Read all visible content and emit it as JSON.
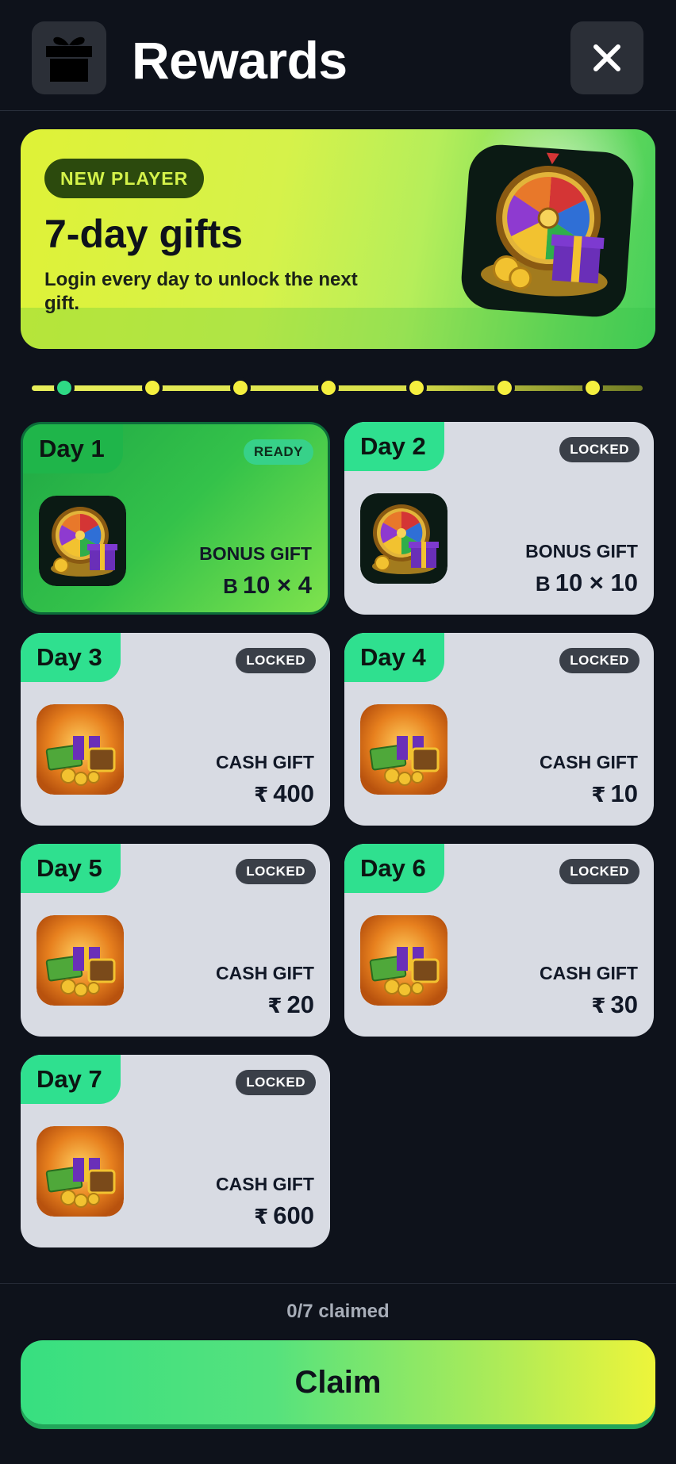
{
  "header": {
    "title": "Rewards"
  },
  "banner": {
    "badge": "NEW PLAYER",
    "title": "7-day gifts",
    "subtitle": "Login every day to unlock the next gift."
  },
  "progress": {
    "total_days": 7,
    "current_day": 1
  },
  "days": [
    {
      "label": "Day 1",
      "status": "READY",
      "gift_type": "BONUS GIFT",
      "currency": "B",
      "amount": "10 × 4",
      "art": "prize-wheel-icon"
    },
    {
      "label": "Day 2",
      "status": "LOCKED",
      "gift_type": "BONUS GIFT",
      "currency": "B",
      "amount": "10 × 10",
      "art": "prize-wheel-icon"
    },
    {
      "label": "Day 3",
      "status": "LOCKED",
      "gift_type": "CASH GIFT",
      "currency": "₹",
      "amount": "400",
      "art": "treasure-cash-icon"
    },
    {
      "label": "Day 4",
      "status": "LOCKED",
      "gift_type": "CASH GIFT",
      "currency": "₹",
      "amount": "10",
      "art": "treasure-cash-icon"
    },
    {
      "label": "Day 5",
      "status": "LOCKED",
      "gift_type": "CASH GIFT",
      "currency": "₹",
      "amount": "20",
      "art": "treasure-cash-icon"
    },
    {
      "label": "Day 6",
      "status": "LOCKED",
      "gift_type": "CASH GIFT",
      "currency": "₹",
      "amount": "30",
      "art": "treasure-cash-icon"
    },
    {
      "label": "Day 7",
      "status": "LOCKED",
      "gift_type": "CASH GIFT",
      "currency": "₹",
      "amount": "600",
      "art": "treasure-cash-icon"
    }
  ],
  "footer": {
    "claimed_text": "0/7 claimed",
    "claim_label": "Claim"
  },
  "colors": {
    "accent_green": "#2fe08f",
    "accent_yellow": "#eef53a",
    "background": "#0e121b",
    "locked_card": "#d8dbe3"
  }
}
